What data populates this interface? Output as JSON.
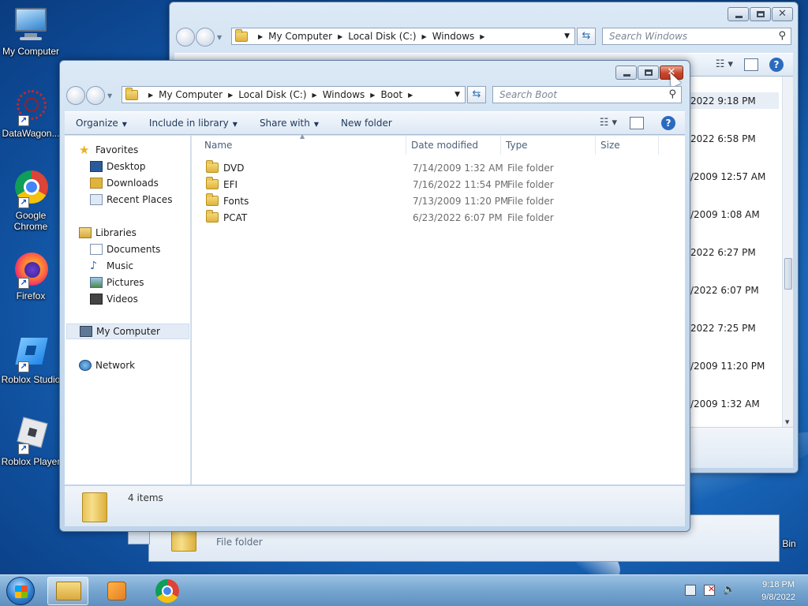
{
  "desktop": {
    "icons": [
      {
        "label": "My Computer"
      },
      {
        "label": "DataWagon..."
      },
      {
        "label": "Google Chrome"
      },
      {
        "label": "Firefox"
      },
      {
        "label": "Roblox Studio"
      },
      {
        "label": "Roblox Player"
      }
    ],
    "bin_label": "Bin"
  },
  "back_window": {
    "breadcrumbs": [
      "My Computer",
      "Local Disk (C:)",
      "Windows"
    ],
    "search_placeholder": "Search Windows",
    "dates": [
      "2022 9:18 PM",
      "2022 6:58 PM",
      "/2009 12:57 AM",
      "/2009 1:08 AM",
      "2022 6:27 PM",
      "/2022 6:07 PM",
      "2022 7:25 PM",
      "/2009 11:20 PM",
      "/2009 1:32 AM"
    ],
    "status_type": "File folder"
  },
  "front_window": {
    "breadcrumbs": [
      "My Computer",
      "Local Disk (C:)",
      "Windows",
      "Boot"
    ],
    "search_placeholder": "Search Boot",
    "toolbar": {
      "organize": "Organize",
      "include_in_library": "Include in library",
      "share_with": "Share with",
      "new_folder": "New folder"
    },
    "nav": {
      "favorites": "Favorites",
      "desktop": "Desktop",
      "downloads": "Downloads",
      "recent_places": "Recent Places",
      "libraries": "Libraries",
      "documents": "Documents",
      "music": "Music",
      "pictures": "Pictures",
      "videos": "Videos",
      "my_computer": "My Computer",
      "network": "Network"
    },
    "columns": {
      "name": "Name",
      "date_modified": "Date modified",
      "type": "Type",
      "size": "Size"
    },
    "files": [
      {
        "name": "DVD",
        "date": "7/14/2009 1:32 AM",
        "type": "File folder"
      },
      {
        "name": "EFI",
        "date": "7/16/2022 11:54 PM",
        "type": "File folder"
      },
      {
        "name": "Fonts",
        "date": "7/13/2009 11:20 PM",
        "type": "File folder"
      },
      {
        "name": "PCAT",
        "date": "6/23/2022 6:07 PM",
        "type": "File folder"
      }
    ],
    "status_count": "4 items"
  },
  "taskbar": {
    "time": "9:18 PM",
    "date": "9/8/2022"
  }
}
